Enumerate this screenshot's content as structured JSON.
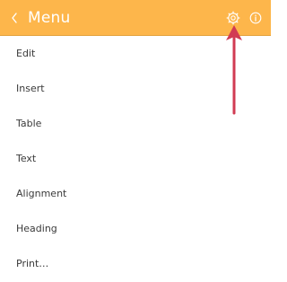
{
  "header": {
    "title": "Menu",
    "back_icon": "chevron-left-icon",
    "settings_icon": "gear-icon",
    "info_icon": "info-icon",
    "background_color": "#fdb64b"
  },
  "menu": {
    "items": [
      {
        "label": "Edit"
      },
      {
        "label": "Insert"
      },
      {
        "label": "Table"
      },
      {
        "label": "Text"
      },
      {
        "label": "Alignment"
      },
      {
        "label": "Heading"
      },
      {
        "label": "Print…"
      }
    ]
  },
  "annotation": {
    "arrow_icon": "arrow-up-icon",
    "arrow_color": "#d13b53"
  }
}
